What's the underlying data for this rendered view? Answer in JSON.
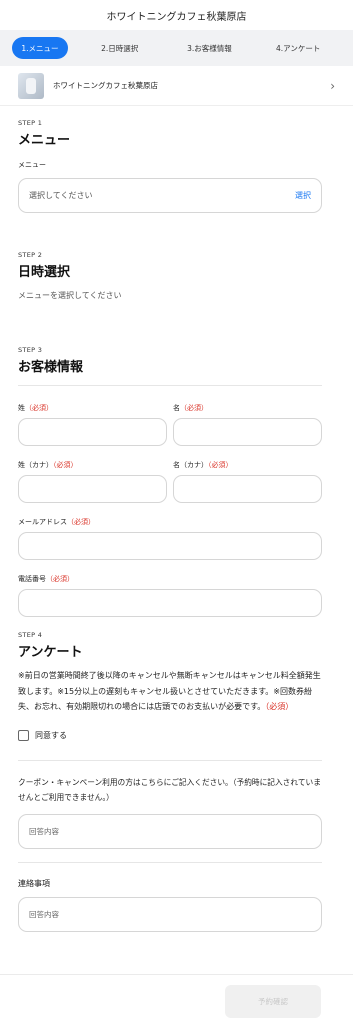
{
  "header": {
    "title": "ホワイトニングカフェ秋葉原店"
  },
  "tabs": [
    {
      "label": "1.メニュー"
    },
    {
      "label": "2.日時選択"
    },
    {
      "label": "3.お客様情報"
    },
    {
      "label": "4.アンケート"
    }
  ],
  "shop": {
    "name": "ホワイトニングカフェ秋葉原店",
    "chevron": "›"
  },
  "step1": {
    "step": "STEP 1",
    "title": "メニュー",
    "field_label": "メニュー",
    "placeholder": "選択してください",
    "action": "選択"
  },
  "step2": {
    "step": "STEP 2",
    "title": "日時選択",
    "message": "メニューを選択してください"
  },
  "step3": {
    "step": "STEP 3",
    "title": "お客様情報",
    "required": "（必須）",
    "last_name": "姓",
    "first_name": "名",
    "last_kana": "姓（カナ）",
    "first_kana": "名（カナ）",
    "email": "メールアドレス",
    "phone": "電話番号"
  },
  "step4": {
    "step": "STEP 4",
    "title": "アンケート",
    "notice": "※前日の営業時間終了後以降のキャンセルや無断キャンセルはキャンセル料全額発生致します。※15分以上の遅刻もキャンセル扱いとさせていただきます。※回数券紛失、お忘れ、有効期限切れの場合には店頭でのお支払いが必要です。",
    "notice_required": "（必須）",
    "agree": "同意する",
    "coupon_question": "クーポン・キャンペーン利用の方はこちらにご記入ください。（予約時に記入されていませんとご利用できません。）",
    "answer_placeholder": "回答内容",
    "contact_label": "連絡事項"
  },
  "footer": {
    "submit": "予約確認"
  },
  "colors": {
    "accent": "#1877f2",
    "required": "#d93025"
  }
}
